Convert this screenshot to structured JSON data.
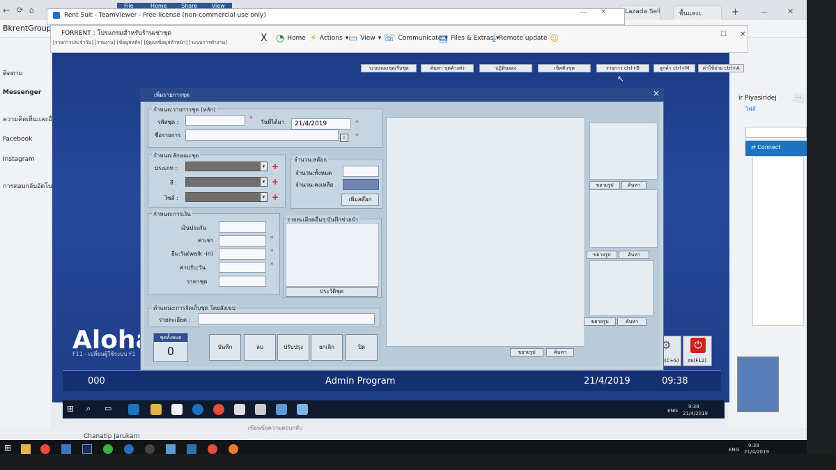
{
  "outer_browser": {
    "tabs": [
      "Lazada Sell",
      "พื้นและเ"
    ],
    "address": "BkrentGroup S",
    "new_tab": "+"
  },
  "facebook_sidebar": {
    "items": [
      "ติดตาม",
      "Messenger",
      "ความคิดเห็นและอื่นๆ",
      "Facebook",
      "Instagram",
      "การตอบกลับอัตโนมัติ"
    ],
    "right_name": "ir Piyasiridej",
    "right_more": "···",
    "right_sub": "ไฟส์",
    "connect_label": "Connect",
    "bottom_name": "Chanatip Jarukarn",
    "bottom_hint": "เขียนข้อความตอบกลับ"
  },
  "teamviewer": {
    "title": "Rent Suit - TeamViewer - Free license (non-commercial use only)",
    "ribbon_tabs": [
      "File",
      "Home",
      "Share",
      "View"
    ],
    "remote_title": "FORRENT : โปรแกรมสำหรับร้านเช่าชุด",
    "remote_menu": "[รายการประจำวัน]    [รายงาน]    [ข้อมูลหลัก]    [ผู้ดูแลข้อมูลหัวหน้า]    [ระบบการทำงาน]",
    "toolbar": {
      "close": "X",
      "home": "Home",
      "actions": "Actions",
      "view": "View",
      "communicate": "Communicate",
      "files": "Files & Extras",
      "remote_update": "Remote update"
    }
  },
  "app": {
    "top_buttons": [
      "ระบบจองชุด/รับชุด",
      "ค้นหา ชุดค้างส่ง",
      "ปฏิทินจอง",
      "เช็คคิวชุด",
      "รายการ ctrl+B",
      "ลูกค้า ctrl+M",
      "ค่าใช้จ่าย ctrl+A"
    ],
    "brand": "Aloha",
    "brand_sub": "F11 - เปลี่ยนผู้ใช้ระบบ   F1",
    "status_left": "000",
    "status_center": "Admin Program",
    "status_date": "21/4/2019",
    "status_time": "09:38",
    "right_buttons": {
      "cart": "ขาย(C+S)",
      "exit": "จบ(F12)"
    }
  },
  "dialog": {
    "title": "เพิ่มรายการชุด",
    "close": "×",
    "main_group": {
      "label": "กำหนด:รายการชุด (หลัก)",
      "code_label": "รหัสชุด :",
      "code_value": "",
      "date_label": "วันที่ได้มา",
      "date_value": "21/4/2019",
      "name_label": "ชื่อรายการ",
      "name_value": "",
      "required": "*"
    },
    "attr_group": {
      "label": "กำหนด:ลักษณะชุด",
      "type_label": "ประเภท :",
      "color_label": "สี :",
      "size_label": "ไซส์ :",
      "add": "+"
    },
    "stock_group": {
      "label": "จำนวน:สต๊อก",
      "total_label": "จำนวน:ทั้งหมด",
      "remain_label": "จำนวน:คงเหลือ",
      "add_stock_button": "เพิ่มสต๊อก"
    },
    "money_group": {
      "label": "กำหนด:การเงิน",
      "deposit_label": "เงินประกัน",
      "rent_label": "ค่าเช่า",
      "borrow_label": "ยืม:วัน(walk -in)",
      "fine_label": "ค่าปรับ:วัน",
      "price_label": "ราคาชุด"
    },
    "detail_group": {
      "label": "รายละเอียดอื่นๆ:บันทึกช่วยจำ",
      "history_button": "ประวัติชุด"
    },
    "location_group": {
      "label": "ตำแหน่ง:การจัดเก็บชุด โดยสังเขป",
      "detail_label": "รายละเอียด :"
    },
    "count": {
      "label": "ชุดทั้งหมด",
      "value": "0"
    },
    "actions": [
      "บันทึก",
      "ลบ",
      "ปรับปรุง",
      "ยกเลิก",
      "ปิด"
    ],
    "image_panel_buttons": {
      "enlarge": "ขยายรูป",
      "search": "ค้นหา"
    }
  },
  "remote_taskbar": {
    "lang": "ENG",
    "time": "9:38",
    "date": "21/4/2019"
  },
  "outer_taskbar": {
    "lang": "ENG",
    "time": "9:38",
    "date": "21/4/2019"
  }
}
